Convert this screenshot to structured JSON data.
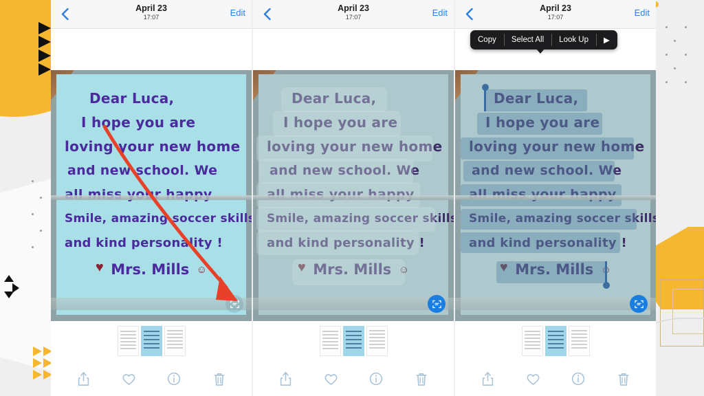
{
  "app": {
    "name": "Photos",
    "accent_blue": "#2f7fe0",
    "live_text_active_color": "#1a7de0",
    "selection_color": "#46a0dc",
    "menu_bg": "#1c1c1e",
    "note_color": "#aee1e8",
    "ink_color": "#4a2a9c",
    "heart_color": "#8e2330",
    "annotation_arrow_color": "#e8412a",
    "bg_orange": "#f5b730"
  },
  "nav": {
    "back_label": "chevron-left-icon",
    "title": "April 23",
    "subtitle": "17:07",
    "edit_label": "Edit"
  },
  "note": {
    "lines": [
      "Dear Luca,",
      "I hope you are",
      "loving your new home",
      "and new school. We",
      "all miss your  happy",
      "Smile, amazing soccer skills,",
      "and kind personality !"
    ],
    "signature_heart": "♥",
    "signature_name": "Mrs. Mills",
    "signature_smiley": "☺",
    "full_text": "Dear Luca, I hope you are loving your new home and new school. We all miss your happy Smile, amazing soccer skills, and kind personality ! Mrs. Mills"
  },
  "live_text_button": {
    "name": "live-text-button",
    "state_panel_1": "idle",
    "state_panel_2": "active",
    "state_panel_3": "active"
  },
  "context_menu": {
    "items": [
      {
        "label": "Copy",
        "name": "copy-menu-item"
      },
      {
        "label": "Select All",
        "name": "select-all-menu-item"
      },
      {
        "label": "Look Up",
        "name": "look-up-menu-item"
      },
      {
        "label": "▶",
        "name": "more-menu-item"
      }
    ]
  },
  "toolbar": {
    "items": [
      {
        "label": "Share",
        "name": "share-icon"
      },
      {
        "label": "Favorite",
        "name": "heart-icon"
      },
      {
        "label": "Info",
        "name": "info-icon"
      },
      {
        "label": "Delete",
        "name": "trash-icon"
      }
    ]
  },
  "filmstrip": {
    "thumbnails": [
      {
        "name": "thumbnail-document-1",
        "selected": false
      },
      {
        "name": "thumbnail-blue-note",
        "selected": true
      },
      {
        "name": "thumbnail-document-2",
        "selected": false
      }
    ]
  },
  "panels": [
    {
      "name": "panel-1-photo-view",
      "step": "1",
      "state": "normal"
    },
    {
      "name": "panel-2-text-detected",
      "step": "2",
      "state": "live-text-detected"
    },
    {
      "name": "panel-3-text-selected",
      "step": "3",
      "state": "text-selected-with-menu"
    }
  ],
  "annotation": {
    "type": "curved-arrow",
    "points_to": "live-text-button"
  }
}
